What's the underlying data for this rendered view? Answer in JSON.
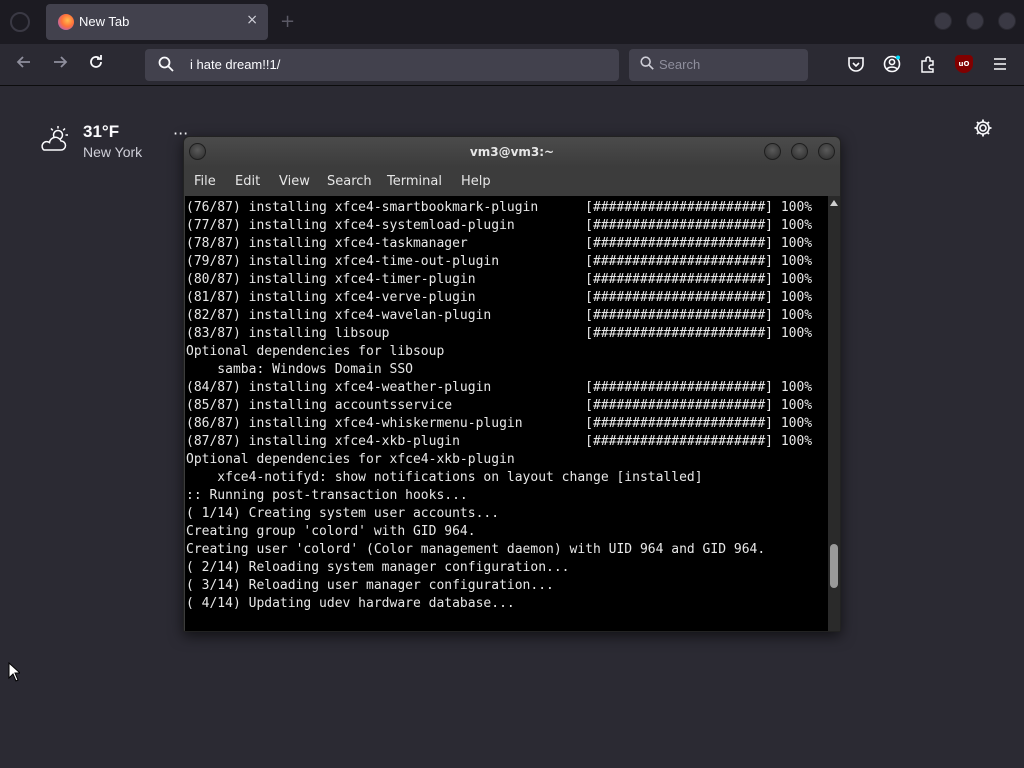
{
  "browser": {
    "tab": {
      "title": "New Tab",
      "close_glyph": "×"
    },
    "new_tab_glyph": "+",
    "urlbar": {
      "value": "i hate dream!!1/"
    },
    "searchbar": {
      "placeholder": "Search"
    },
    "toolbar_icons": [
      "pocket-icon",
      "account-icon",
      "extensions-icon",
      "ublock-origin-icon",
      "menu-icon"
    ],
    "ublock_label": "uO"
  },
  "newtab": {
    "weather": {
      "temp": "31°F",
      "city": "New York",
      "more_glyph": "···"
    }
  },
  "terminal": {
    "title": "vm3@vm3:~",
    "menu": [
      "File",
      "Edit",
      "View",
      "Search",
      "Terminal",
      "Help"
    ],
    "lines": [
      "(76/87) installing xfce4-smartbookmark-plugin      [######################] 100%",
      "(77/87) installing xfce4-systemload-plugin         [######################] 100%",
      "(78/87) installing xfce4-taskmanager               [######################] 100%",
      "(79/87) installing xfce4-time-out-plugin           [######################] 100%",
      "(80/87) installing xfce4-timer-plugin              [######################] 100%",
      "(81/87) installing xfce4-verve-plugin              [######################] 100%",
      "(82/87) installing xfce4-wavelan-plugin            [######################] 100%",
      "(83/87) installing libsoup                         [######################] 100%",
      "Optional dependencies for libsoup",
      "    samba: Windows Domain SSO",
      "(84/87) installing xfce4-weather-plugin            [######################] 100%",
      "(85/87) installing accountsservice                 [######################] 100%",
      "(86/87) installing xfce4-whiskermenu-plugin        [######################] 100%",
      "(87/87) installing xfce4-xkb-plugin                [######################] 100%",
      "Optional dependencies for xfce4-xkb-plugin",
      "    xfce4-notifyd: show notifications on layout change [installed]",
      ":: Running post-transaction hooks...",
      "( 1/14) Creating system user accounts...",
      "Creating group 'colord' with GID 964.",
      "Creating user 'colord' (Color management daemon) with UID 964 and GID 964.",
      "( 2/14) Reloading system manager configuration...",
      "( 3/14) Reloading user manager configuration...",
      "( 4/14) Updating udev hardware database..."
    ],
    "scroll_position": 0.92
  }
}
